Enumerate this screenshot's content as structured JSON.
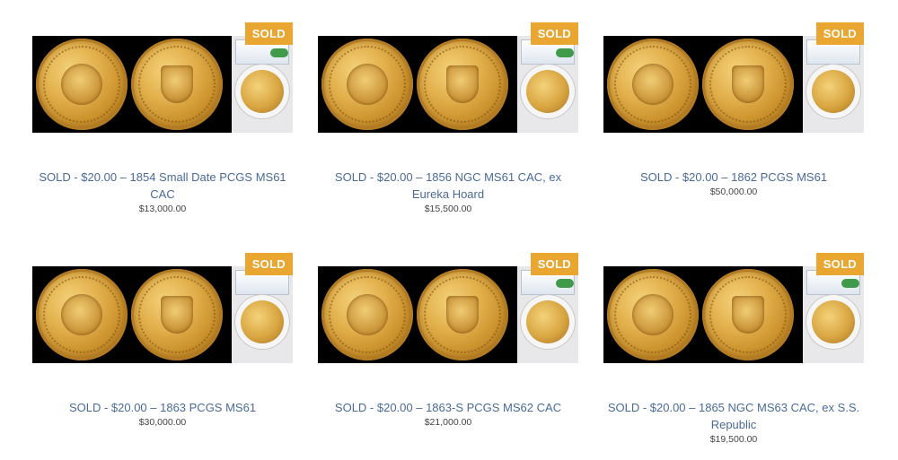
{
  "listings": [
    {
      "badge": "SOLD",
      "title": "SOLD - $20.00 – 1854 Small Date PCGS MS61 CAC",
      "price": "$13,000.00"
    },
    {
      "badge": "SOLD",
      "title": "SOLD - $20.00 – 1856 NGC MS61 CAC, ex Eureka Hoard",
      "price": "$15,500.00"
    },
    {
      "badge": "SOLD",
      "title": "SOLD - $20.00 – 1862 PCGS MS61",
      "price": "$50,000.00"
    },
    {
      "badge": "SOLD",
      "title": "SOLD - $20.00 – 1863 PCGS MS61",
      "price": "$30,000.00"
    },
    {
      "badge": "SOLD",
      "title": "SOLD - $20.00 – 1863-S PCGS MS62 CAC",
      "price": "$21,000.00"
    },
    {
      "badge": "SOLD",
      "title": "SOLD - $20.00 – 1865 NGC MS63 CAC, ex S.S. Republic",
      "price": "$19,500.00"
    }
  ],
  "colors": {
    "badge": "#e9a630",
    "title": "#4a6a9a",
    "price": "#444444"
  }
}
